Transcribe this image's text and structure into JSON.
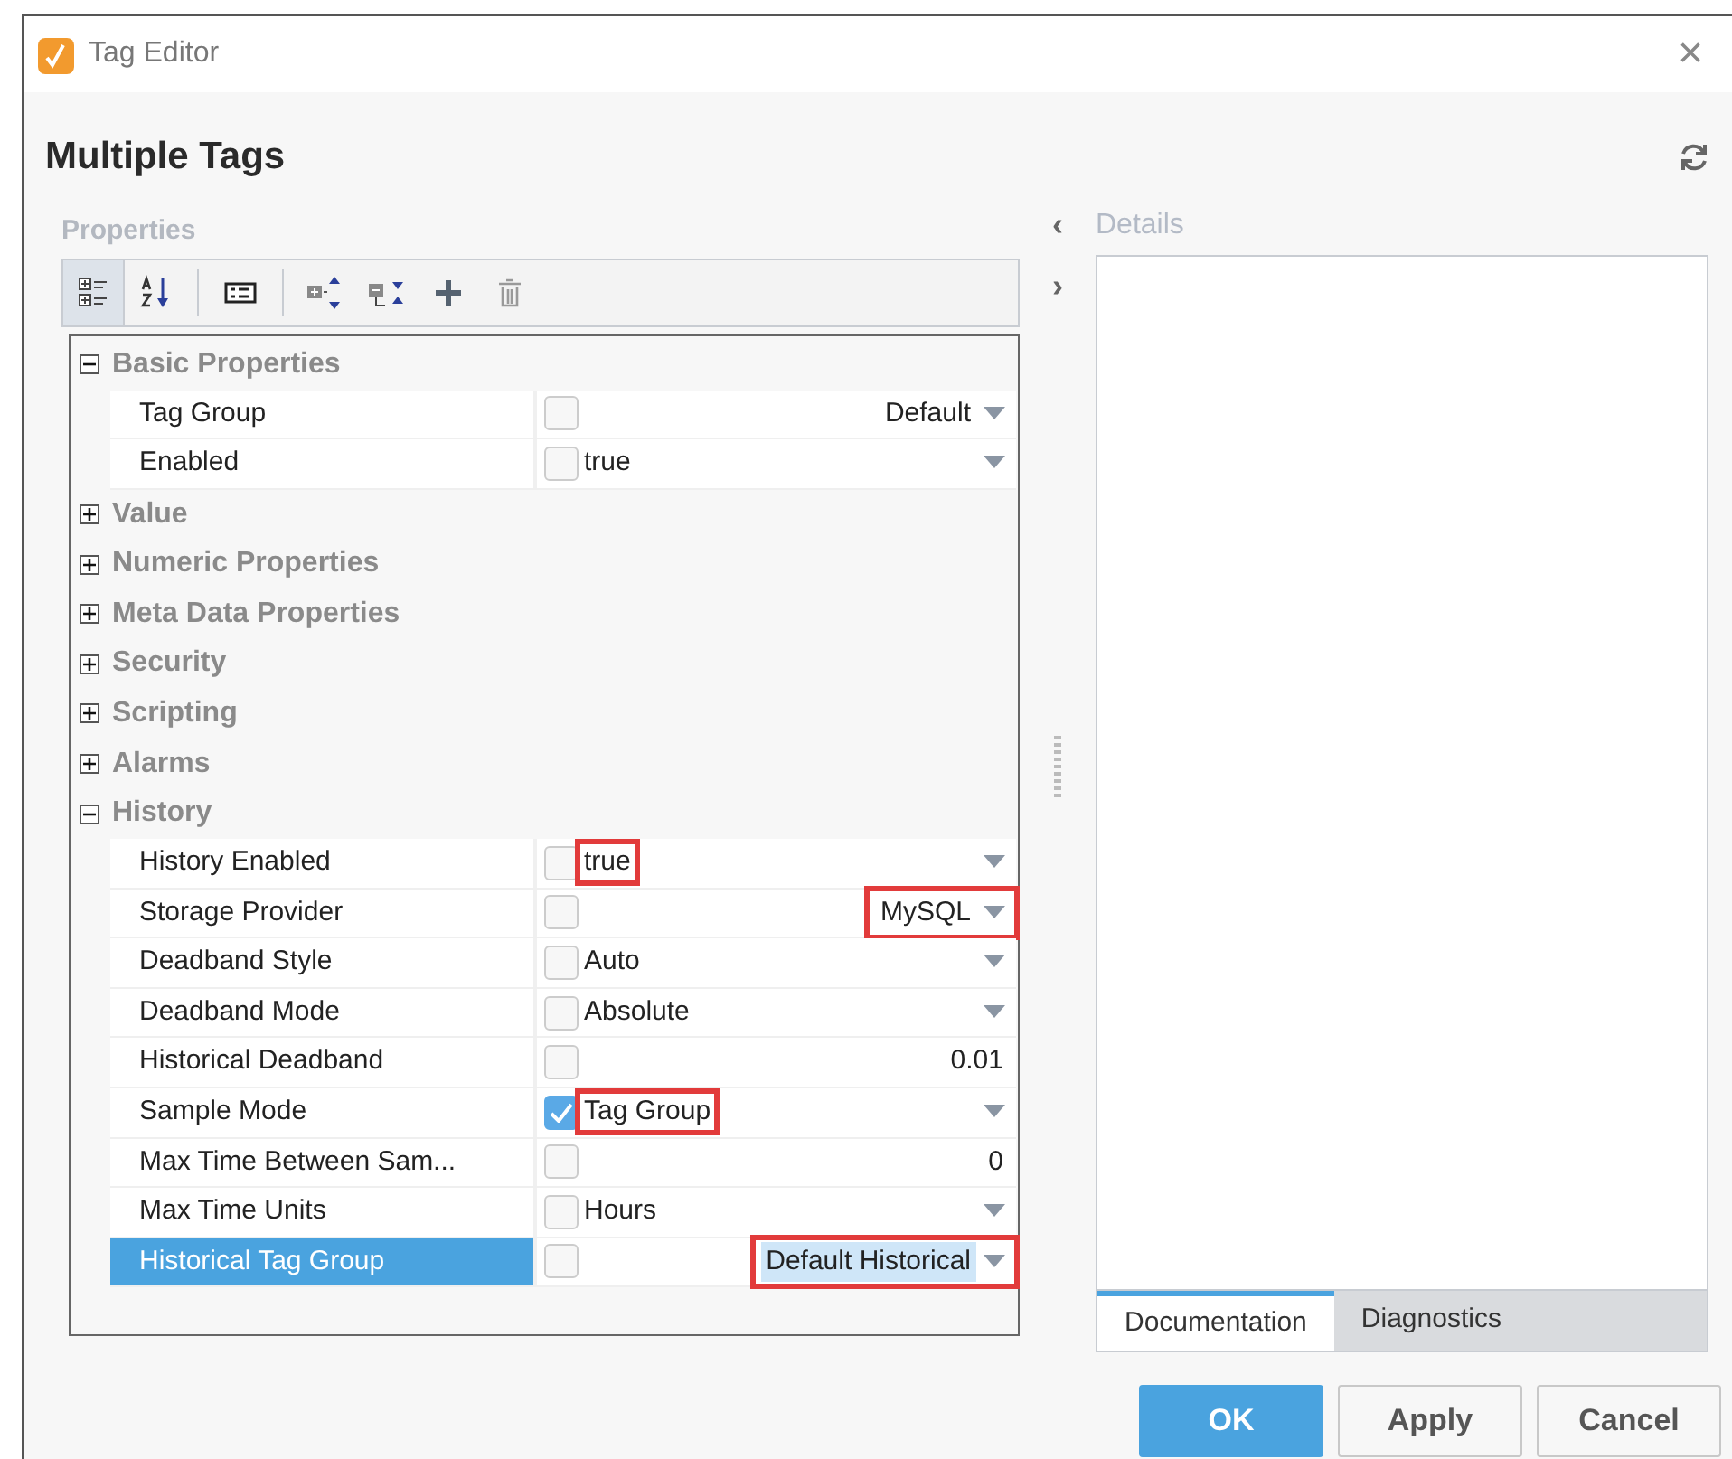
{
  "window": {
    "title": "Tag Editor",
    "close": "×"
  },
  "heading": "Multiple Tags",
  "properties_label": "Properties",
  "toolbar": [
    {
      "kind": "categorized",
      "selected": true
    },
    {
      "kind": "sort",
      "selected": false
    },
    {
      "kind": "form",
      "selected": false
    },
    {
      "kind": "expand",
      "selected": false
    },
    {
      "kind": "collapse",
      "selected": false
    },
    {
      "kind": "add",
      "selected": false
    },
    {
      "kind": "delete",
      "selected": false
    }
  ],
  "groups": [
    {
      "name": "Basic Properties",
      "expanded": true,
      "rows": [
        {
          "name": "Tag Group",
          "kind": "list",
          "value": "Default",
          "checked": false,
          "selected": false,
          "annotated": false
        },
        {
          "name": "Enabled",
          "kind": "enum",
          "value": "true",
          "checked": false,
          "selected": false,
          "annotated": false
        }
      ]
    },
    {
      "name": "Value",
      "expanded": false
    },
    {
      "name": "Numeric Properties",
      "expanded": false
    },
    {
      "name": "Meta Data Properties",
      "expanded": false
    },
    {
      "name": "Security",
      "expanded": false
    },
    {
      "name": "Scripting",
      "expanded": false
    },
    {
      "name": "Alarms",
      "expanded": false
    },
    {
      "name": "History",
      "expanded": true,
      "rows": [
        {
          "name": "History Enabled",
          "kind": "enum",
          "value": "true",
          "checked": false,
          "selected": false,
          "annotated": true
        },
        {
          "name": "Storage Provider",
          "kind": "list",
          "value": "MySQL",
          "checked": false,
          "selected": false,
          "annotated": true
        },
        {
          "name": "Deadband Style",
          "kind": "enum",
          "value": "Auto",
          "checked": false,
          "selected": false,
          "annotated": false
        },
        {
          "name": "Deadband Mode",
          "kind": "enum",
          "value": "Absolute",
          "checked": false,
          "selected": false,
          "annotated": false
        },
        {
          "name": "Historical Deadband",
          "kind": "number",
          "value": "0.01",
          "checked": false,
          "selected": false,
          "annotated": false
        },
        {
          "name": "Sample Mode",
          "kind": "enum",
          "value": "Tag Group",
          "checked": true,
          "selected": false,
          "annotated": true
        },
        {
          "name": "Max Time Between Sam...",
          "kind": "number",
          "value": "0",
          "checked": false,
          "selected": false,
          "annotated": false
        },
        {
          "name": "Max Time Units",
          "kind": "enum",
          "value": "Hours",
          "checked": false,
          "selected": false,
          "annotated": false
        },
        {
          "name": "Historical Tag Group",
          "kind": "list",
          "value": "Default Historical",
          "checked": false,
          "selected": true,
          "annotated": true
        }
      ]
    }
  ],
  "details": {
    "label": "Details",
    "collapse": "‹",
    "expand": "›",
    "tabs": [
      {
        "label": "Documentation",
        "selected": true
      },
      {
        "label": "Diagnostics",
        "selected": false
      }
    ]
  },
  "buttons": [
    {
      "label": "OK",
      "primary": true
    },
    {
      "label": "Apply",
      "primary": false
    },
    {
      "label": "Cancel",
      "primary": false
    }
  ]
}
